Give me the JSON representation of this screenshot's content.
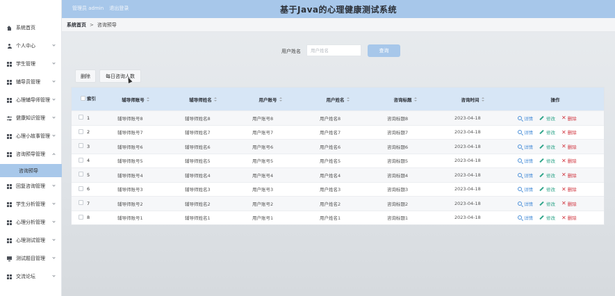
{
  "header": {
    "user_label": "管理员 admin",
    "logout_label": "退出登录",
    "title": "基于Java的心理健康测试系统"
  },
  "sidebar": {
    "items": [
      {
        "label": "系统首页",
        "icon": "home-icon"
      },
      {
        "label": "个人中心",
        "icon": "user-icon"
      },
      {
        "label": "学生管理",
        "icon": "grid-icon"
      },
      {
        "label": "辅导员管理",
        "icon": "grid-icon"
      },
      {
        "label": "心理辅导师管理",
        "icon": "grid-icon"
      },
      {
        "label": "健康知识管理",
        "icon": "sliders-icon"
      },
      {
        "label": "心理小故事管理",
        "icon": "grid-icon"
      },
      {
        "label": "咨询预导管理",
        "icon": "grid-icon"
      },
      {
        "label": "回复咨询管理",
        "icon": "grid-icon"
      },
      {
        "label": "学生分析管理",
        "icon": "grid-icon"
      },
      {
        "label": "心理分析管理",
        "icon": "grid-icon"
      },
      {
        "label": "心理测试管理",
        "icon": "grid-icon"
      },
      {
        "label": "测试题目管理",
        "icon": "monitor-icon"
      },
      {
        "label": "交流论坛",
        "icon": "grid-icon"
      }
    ],
    "active_sub": "咨询预导"
  },
  "breadcrumb": {
    "home": "系统首页",
    "separator": ">",
    "current": "咨询预导"
  },
  "search": {
    "label": "用户姓名",
    "placeholder": "用户姓名",
    "button": "查询"
  },
  "actions": {
    "delete": "删除",
    "daily": "每日咨询人数"
  },
  "table": {
    "headers": {
      "index": "索引",
      "counselor_account": "辅导师账号",
      "counselor_name": "辅导师姓名",
      "user_account": "用户账号",
      "user_name": "用户姓名",
      "subject": "咨询标题",
      "time": "咨询时间",
      "ops": "操作"
    },
    "op_labels": {
      "detail": "详情",
      "edit": "修改",
      "remove": "删除"
    },
    "rows": [
      {
        "index": "1",
        "counselor_account": "辅导师账号8",
        "counselor_name": "辅导师姓名8",
        "user_account": "用户账号8",
        "user_name": "用户姓名8",
        "subject": "咨询标题8",
        "time": "2023-04-18"
      },
      {
        "index": "2",
        "counselor_account": "辅导师账号7",
        "counselor_name": "辅导师姓名7",
        "user_account": "用户账号7",
        "user_name": "用户姓名7",
        "subject": "咨询标题7",
        "time": "2023-04-18"
      },
      {
        "index": "3",
        "counselor_account": "辅导师账号6",
        "counselor_name": "辅导师姓名6",
        "user_account": "用户账号6",
        "user_name": "用户姓名6",
        "subject": "咨询标题6",
        "time": "2023-04-18"
      },
      {
        "index": "4",
        "counselor_account": "辅导师账号5",
        "counselor_name": "辅导师姓名5",
        "user_account": "用户账号5",
        "user_name": "用户姓名5",
        "subject": "咨询标题5",
        "time": "2023-04-18"
      },
      {
        "index": "5",
        "counselor_account": "辅导师账号4",
        "counselor_name": "辅导师姓名4",
        "user_account": "用户账号4",
        "user_name": "用户姓名4",
        "subject": "咨询标题4",
        "time": "2023-04-18"
      },
      {
        "index": "6",
        "counselor_account": "辅导师账号3",
        "counselor_name": "辅导师姓名3",
        "user_account": "用户账号3",
        "user_name": "用户姓名3",
        "subject": "咨询标题3",
        "time": "2023-04-18"
      },
      {
        "index": "7",
        "counselor_account": "辅导师账号2",
        "counselor_name": "辅导师姓名2",
        "user_account": "用户账号2",
        "user_name": "用户姓名2",
        "subject": "咨询标题2",
        "time": "2023-04-18"
      },
      {
        "index": "8",
        "counselor_account": "辅导师账号1",
        "counselor_name": "辅导师姓名1",
        "user_account": "用户账号1",
        "user_name": "用户姓名1",
        "subject": "咨询标题1",
        "time": "2023-04-18"
      }
    ]
  },
  "colors": {
    "header_bg": "#a7c7ea",
    "active_sub_bg": "#a8c8ea",
    "table_head_bg": "#d7e6f6",
    "detail": "#4a8fd8",
    "edit": "#2fa58a",
    "remove": "#d0353f"
  }
}
